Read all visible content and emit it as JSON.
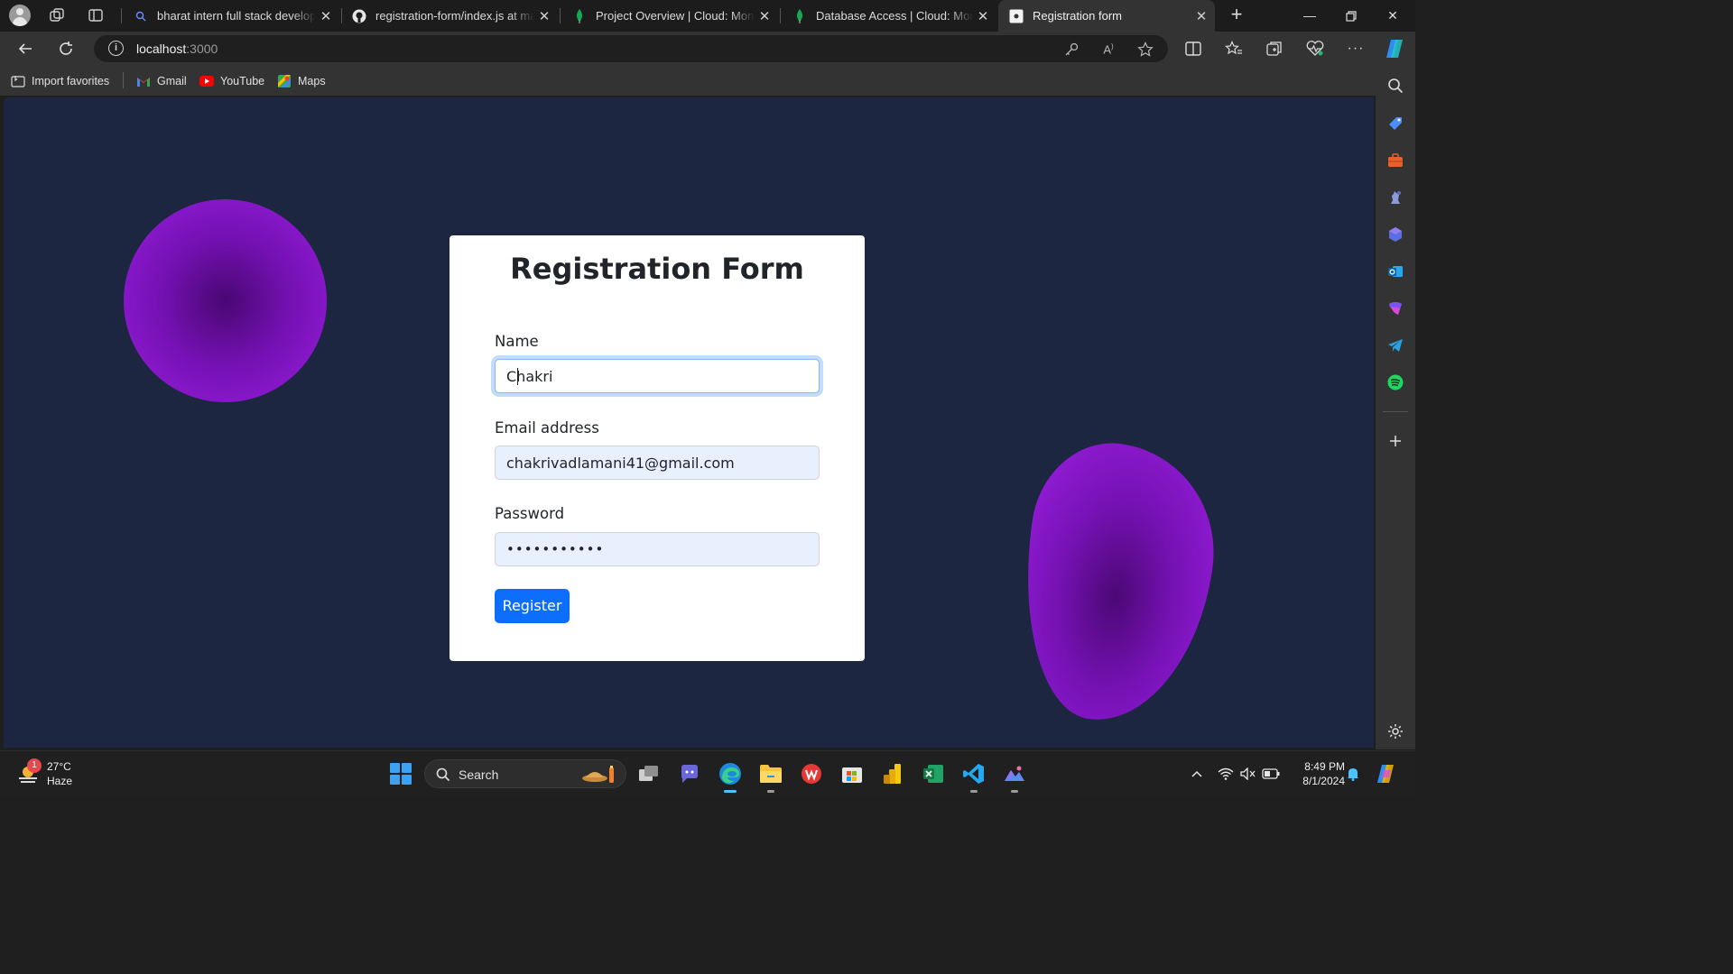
{
  "browser": {
    "tabs": [
      {
        "title": "bharat intern full stack developm",
        "active": false
      },
      {
        "title": "registration-form/index.js at mai",
        "active": false
      },
      {
        "title": "Project Overview | Cloud: Mongo",
        "active": false
      },
      {
        "title": "Database Access | Cloud: Mongo",
        "active": false
      },
      {
        "title": "Registration form",
        "active": true
      }
    ],
    "url_host": "localhost",
    "url_port": ":3000",
    "favorites": [
      {
        "label": "Import favorites"
      },
      {
        "label": "Gmail"
      },
      {
        "label": "YouTube"
      },
      {
        "label": "Maps"
      }
    ]
  },
  "form": {
    "title": "Registration Form",
    "name_label": "Name",
    "name_value_first": "C",
    "name_value_rest": "hakri",
    "email_label": "Email address",
    "email_value": "chakrivadlamani41@gmail.com",
    "password_label": "Password",
    "password_value": "•••••••••••",
    "submit_label": "Register"
  },
  "taskbar": {
    "weather_temp": "27°C",
    "weather_desc": "Haze",
    "weather_badge": "1",
    "search_label": "Search",
    "time": "8:49 PM",
    "date": "8/1/2024"
  },
  "colors": {
    "page_bg": "#1d2640",
    "blob": "#9a1ee0",
    "primary_button": "#0d6efd"
  }
}
